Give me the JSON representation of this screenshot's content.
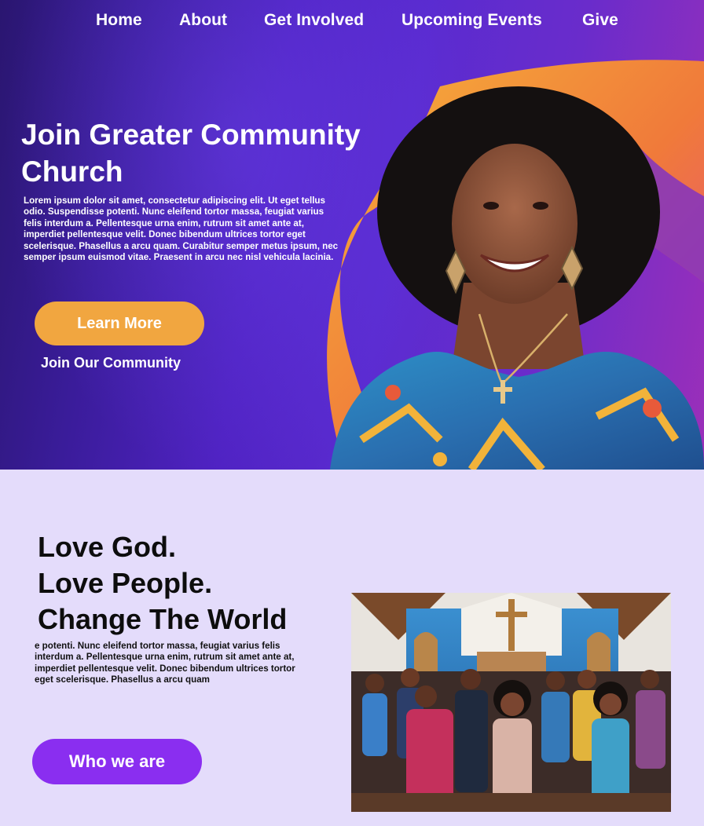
{
  "nav": {
    "items": [
      {
        "label": "Home"
      },
      {
        "label": "About"
      },
      {
        "label": "Get Involved"
      },
      {
        "label": "Upcoming Events"
      },
      {
        "label": "Give"
      }
    ]
  },
  "hero": {
    "title_line1": "Join Greater Community",
    "title_line2": "Church",
    "body": "Lorem ipsum dolor sit amet, consectetur adipiscing elit. Ut eget tellus odio. Suspendisse potenti. Nunc eleifend tortor massa, feugiat varius felis interdum a. Pellentesque urna enim, rutrum sit amet ante at, imperdiet pellentesque velit. Donec bibendum ultrices tortor eget scelerisque. Phasellus a arcu quam. Curabitur semper metus ipsum, nec semper ipsum euismod vitae. Praesent in arcu nec nisl vehicula lacinia.",
    "primary_button": "Learn More",
    "secondary_link": "Join Our Community"
  },
  "about": {
    "title_lines": [
      "Love God.",
      "Love People.",
      "Change The World"
    ],
    "body": "e potenti. Nunc eleifend tortor massa, feugiat varius felis interdum a. Pellentesque urna enim, rutrum sit amet ante at, imperdiet pellentesque velit. Donec bibendum ultrices tortor eget scelerisque. Phasellus a arcu quam",
    "button": "Who we are"
  },
  "colors": {
    "hero_purple": "#4f22c2",
    "hero_magenta": "#9b2fb9",
    "accent_orange": "#f1a640",
    "accent_purple": "#8a2ef0",
    "section_lavender": "#e4dcfb"
  }
}
